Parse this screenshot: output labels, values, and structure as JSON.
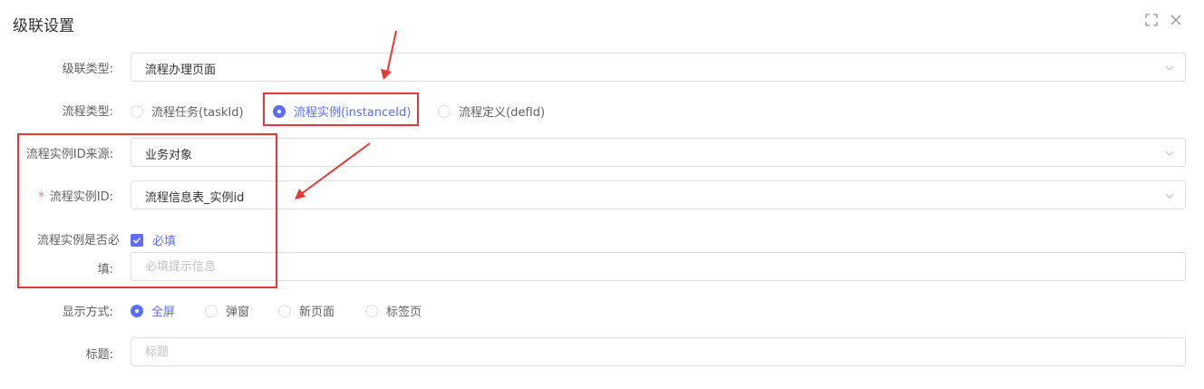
{
  "dialog": {
    "title": "级联设置"
  },
  "form": {
    "cascade_type": {
      "label": "级联类型:",
      "value": "流程办理页面"
    },
    "process_type": {
      "label": "流程类型:",
      "options": [
        "流程任务(taskId)",
        "流程实例(instanceId)",
        "流程定义(defId)"
      ],
      "selected": "流程实例(instanceId)"
    },
    "instance_id_source": {
      "label": "流程实例ID来源:",
      "value": "业务对象"
    },
    "instance_id": {
      "required_mark": "*",
      "label": "流程实例ID:",
      "value": "流程信息表_实例id"
    },
    "instance_required": {
      "label_line1": "流程实例是否必",
      "label_line2": "填:",
      "checkbox_label": "必填",
      "checked": true,
      "placeholder": "必填提示信息"
    },
    "display_mode": {
      "label": "显示方式:",
      "options": [
        "全屏",
        "弹窗",
        "新页面",
        "标签页"
      ],
      "selected": "全屏"
    },
    "title_field": {
      "label": "标题:",
      "placeholder": "标题"
    }
  },
  "colors": {
    "accent": "#5b6ef5",
    "annotation": "#e53935",
    "border": "#dcdfe6"
  },
  "icons": [
    "fullscreen-icon",
    "close-icon",
    "chevron-down-icon",
    "check-icon"
  ]
}
